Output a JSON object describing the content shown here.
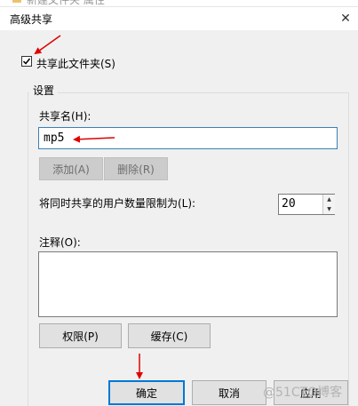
{
  "background_window": {
    "title": "新建文件夹 属性"
  },
  "dialog": {
    "title": "高级共享",
    "close_glyph": "✕"
  },
  "share_checkbox": {
    "label": "共享此文件夹(S)",
    "checked": true
  },
  "settings": {
    "legend": "设置",
    "share_name_label": "共享名(H):",
    "share_name_value": "mp5",
    "add_label": "添加(A)",
    "remove_label": "删除(R)",
    "limit_label": "将同时共享的用户数量限制为(L):",
    "limit_value": "20",
    "comment_label": "注释(O):",
    "comment_value": "",
    "permissions_label": "权限(P)",
    "caching_label": "缓存(C)"
  },
  "footer": {
    "ok_label": "确定",
    "cancel_label": "取消",
    "apply_label": "应用"
  },
  "watermark": "@51CTO博客",
  "colors": {
    "accent": "#0078d7",
    "arrow": "#e00000"
  }
}
